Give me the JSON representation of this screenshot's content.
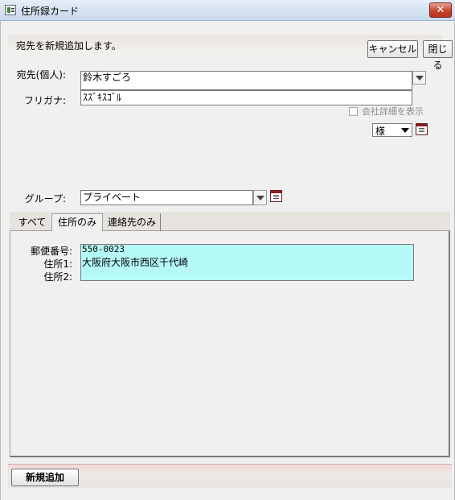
{
  "window": {
    "title": "住所録カード",
    "close_glyph": "✕"
  },
  "message": "宛先を新規追加します。",
  "buttons": {
    "cancel": "キャンセル",
    "close": "閉じる",
    "add_new": "新規追加"
  },
  "form": {
    "addressee_label": "宛先(個人):",
    "addressee_value": "鈴木すごろ",
    "furigana_label": "フリガナ:",
    "furigana_value": "ｽｽﾞｷｽｺﾞﾙ",
    "company_details_label": "会社詳細を表示",
    "company_details_checked": false,
    "honorific_value": "様",
    "group_label": "グループ:",
    "group_value": "プライベート"
  },
  "tabs": [
    {
      "label": "すべて",
      "active": false
    },
    {
      "label": "住所のみ",
      "active": true
    },
    {
      "label": "連絡先のみ",
      "active": false
    }
  ],
  "address": {
    "zip_label": "郵便番号:",
    "address1_label": "住所1:",
    "address2_label": "住所2:",
    "zip_value": "550-0023",
    "address1_value": "大阪府大阪市西区千代崎",
    "address2_value": ""
  },
  "colors": {
    "address_bg": "#b5f8f8",
    "close_button": "#c4452f"
  },
  "icons": [
    "app-window-icon",
    "close-icon",
    "dropdown-arrow-icon",
    "edit-list-icon"
  ]
}
